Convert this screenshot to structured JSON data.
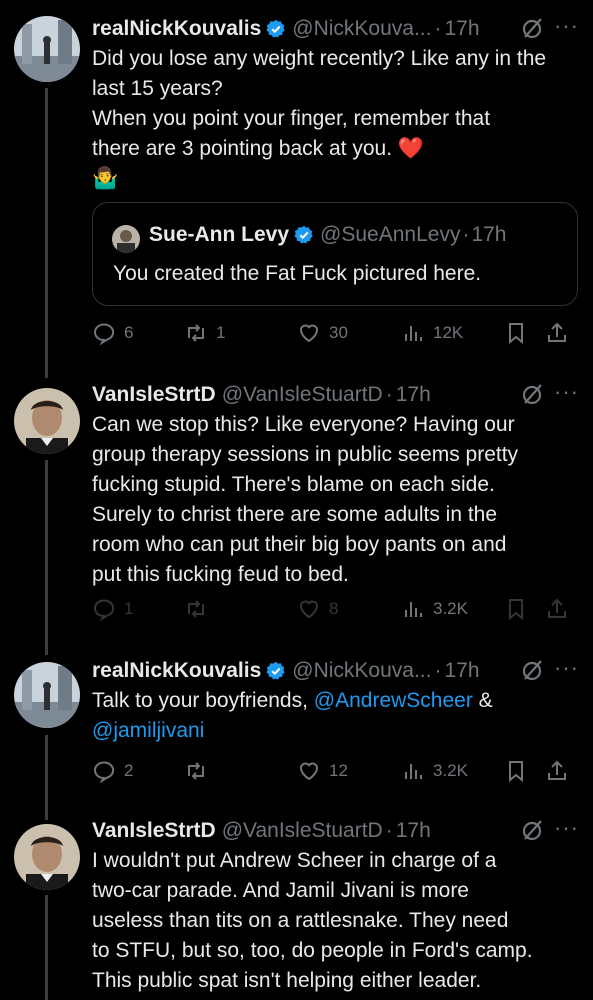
{
  "tweets": [
    {
      "name": "realNickKouvalis",
      "verified": true,
      "handle": "@NickKouva...",
      "sep": "·",
      "time": "17h",
      "text": "Did you lose any weight recently? Like any in the\nlast 15 years?\nWhen you point your finger, remember that\nthere are 3 pointing back at you. ❤️\n🤷‍♂️",
      "quote": {
        "name": "Sue-Ann Levy",
        "handle": "@SueAnnLevy",
        "sep": "·",
        "time": "17h",
        "text": "You created the Fat Fuck pictured here."
      },
      "replies": "6",
      "retweets": "1",
      "likes": "30",
      "views": "12K"
    },
    {
      "name": "VanIsleStrtD",
      "handle": "@VanIsleStuartD",
      "sep": "·",
      "time": "17h",
      "text": "Can we stop this? Like everyone? Having our\ngroup therapy sessions in public seems pretty\nfucking stupid. There's blame on each side.\nSurely to christ there are some adults in the\nroom who can put their big boy pants on and\nput this fucking feud to bed.",
      "replies": "1",
      "retweets": "",
      "likes": "8",
      "views": "3.2K"
    },
    {
      "name": "realNickKouvalis",
      "verified": true,
      "handle": "@NickKouva...",
      "sep": "·",
      "time": "17h",
      "text_before": "Talk to your boyfriends, ",
      "mention1": "@AndrewScheer",
      "text_between": " &",
      "mention2": "@jamiljivani",
      "replies": "2",
      "retweets": "",
      "likes": "12",
      "views": "3.2K"
    },
    {
      "name": "VanIsleStrtD",
      "handle": "@VanIsleStuartD",
      "sep": "·",
      "time": "17h",
      "text": "I wouldn't put Andrew Scheer in charge of a\ntwo-car parade. And Jamil Jivani is more\nuseless than tits on a rattlesnake. They need\nto STFU, but so, too, do people in Ford's camp.\nThis public spat isn't helping either leader."
    }
  ],
  "icons": {
    "more": "···",
    "verified_color": "#1d9bf0",
    "link_color": "#1d9bf0"
  }
}
